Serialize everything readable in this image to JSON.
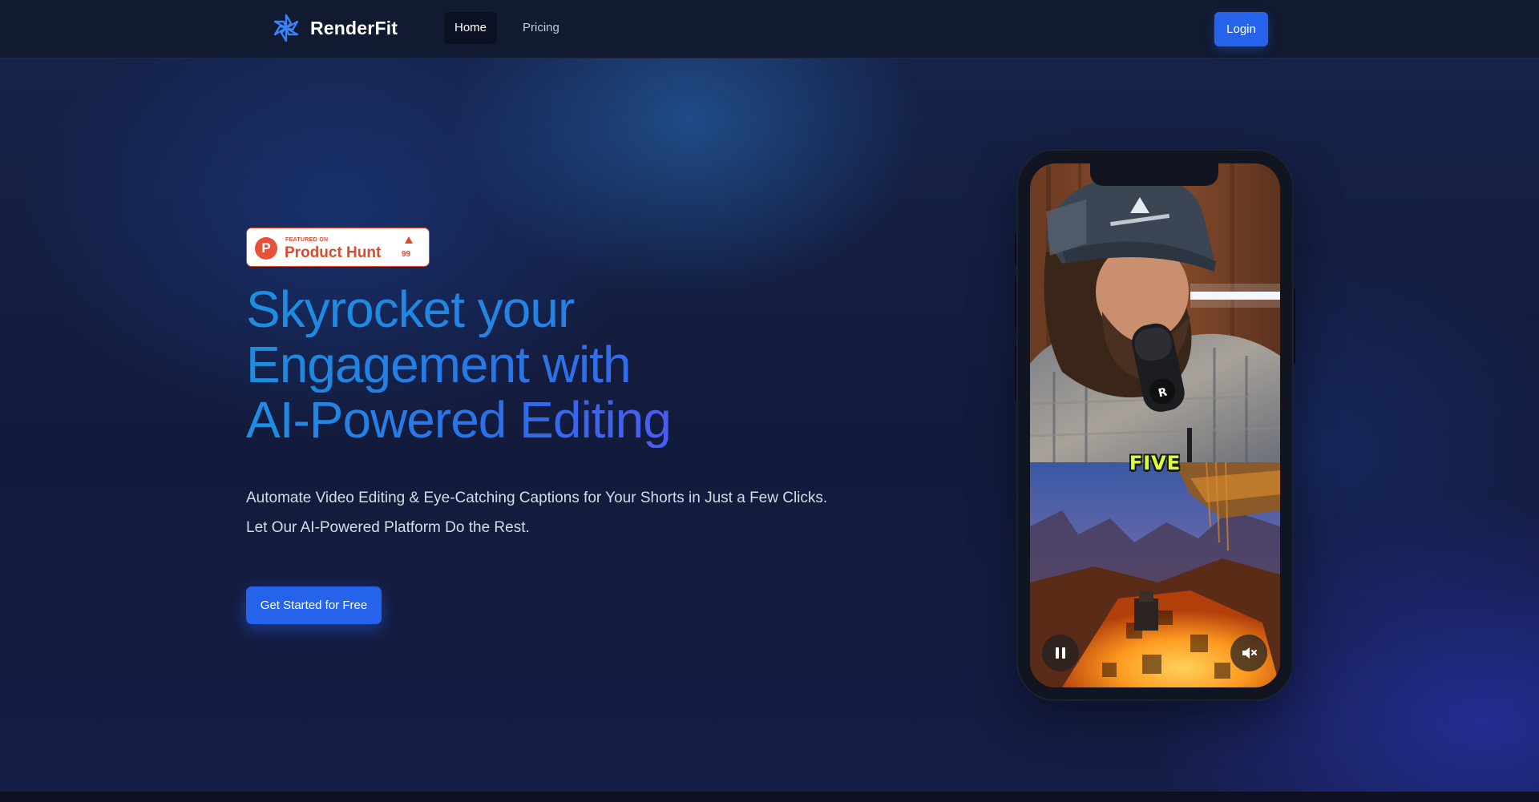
{
  "brand": {
    "name": "RenderFit",
    "logo_icon": "renderfit-logo-icon",
    "accent": "#2563eb"
  },
  "nav": {
    "items": [
      {
        "label": "Home",
        "active": true
      },
      {
        "label": "Pricing",
        "active": false
      }
    ],
    "login_label": "Login"
  },
  "product_hunt": {
    "featured_label": "FEATURED ON",
    "name": "Product Hunt",
    "logo_letter": "P",
    "upvotes": "99",
    "color": "#d84b31"
  },
  "hero": {
    "title_lines": [
      "Skyrocket your",
      "Engagement with",
      "AI-Powered Editing"
    ],
    "subtitle_lines": [
      "Automate Video Editing & Eye-Catching Captions for Your Shorts in Just a Few Clicks.",
      "Let Our AI-Powered Platform Do the Rest."
    ],
    "cta_label": "Get Started for Free"
  },
  "phone_demo": {
    "caption_word": "FIVE",
    "caption_color": "#d7ff3a",
    "controls": {
      "pause_icon": "pause-icon",
      "mute_icon": "mute-icon"
    }
  }
}
